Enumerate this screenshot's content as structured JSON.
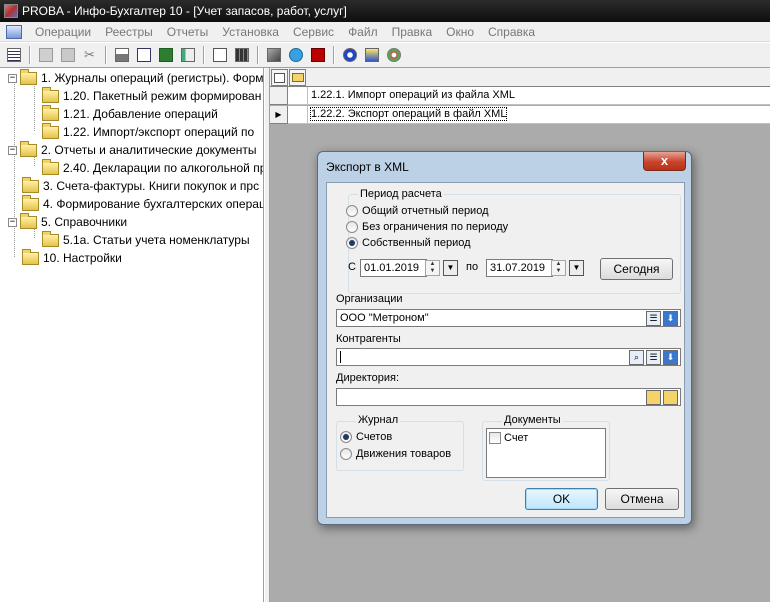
{
  "window": {
    "title": "PROBA - Инфо-Бухгалтер 10 - [Учет запасов, работ, услуг]"
  },
  "menu": {
    "items": [
      "Операции",
      "Реестры",
      "Отчеты",
      "Установка",
      "Сервис",
      "Файл",
      "Правка",
      "Окно",
      "Справка"
    ]
  },
  "toolbar": {
    "icons": [
      "list-icon",
      "copy-icon",
      "paste-icon",
      "cut-icon",
      "print-icon",
      "preview-icon",
      "excel-icon",
      "report-icon",
      "text-doc-icon",
      "calculator-icon",
      "book-icon",
      "help-icon",
      "font-icon",
      "compass-icon",
      "lightbulb-icon",
      "gear-icon"
    ]
  },
  "tree": {
    "items": [
      {
        "label": "1. Журналы операций (регистры). Форм",
        "level": 0,
        "expanded": true
      },
      {
        "label": "1.20. Пакетный режим формирован",
        "level": 1
      },
      {
        "label": "1.21. Добавление операций",
        "level": 1
      },
      {
        "label": "1.22. Импорт/экспорт операций по",
        "level": 1
      },
      {
        "label": "2. Отчеты и аналитические документы",
        "level": 0,
        "expanded": true
      },
      {
        "label": "2.40. Декларации по алкогольной пр",
        "level": 1
      },
      {
        "label": "3. Счета-фактуры. Книги покупок и прс",
        "level": 0
      },
      {
        "label": "4. Формирование бухгалтерских операц",
        "level": 0
      },
      {
        "label": "5. Справочники",
        "level": 0,
        "expanded": true
      },
      {
        "label": "5.1а. Статьи учета номенклатуры",
        "level": 1
      },
      {
        "label": "10. Настройки",
        "level": 0
      }
    ]
  },
  "grid": {
    "rows": [
      {
        "label": "1.22.1. Импорт операций из файла XML",
        "current": false
      },
      {
        "label": "1.22.2. Экспорт операций в файл XML",
        "current": true
      }
    ]
  },
  "dialog": {
    "title": "Экспорт в XML",
    "close_label": "x",
    "period": {
      "group_label": "Период расчета",
      "options": [
        "Общий отчетный период",
        "Без ограничения по периоду",
        "Собственный период"
      ],
      "selected_index": 2,
      "from_label": "С",
      "from_value": "01.01.2019",
      "to_label": "по",
      "to_value": "31.07.2019",
      "today_button": "Сегодня"
    },
    "organizations": {
      "label": "Организации",
      "value": "ООО \"Метроном\""
    },
    "contractors": {
      "label": "Контрагенты",
      "value": ""
    },
    "directory": {
      "label": "Директория:",
      "value": ""
    },
    "journal": {
      "group_label": "Журнал",
      "options": [
        "Счетов",
        "Движения товаров"
      ],
      "selected_index": 0
    },
    "documents": {
      "group_label": "Документы",
      "items": [
        {
          "label": "Счет",
          "checked": false
        }
      ]
    },
    "ok_button": "OK",
    "cancel_button": "Отмена"
  }
}
